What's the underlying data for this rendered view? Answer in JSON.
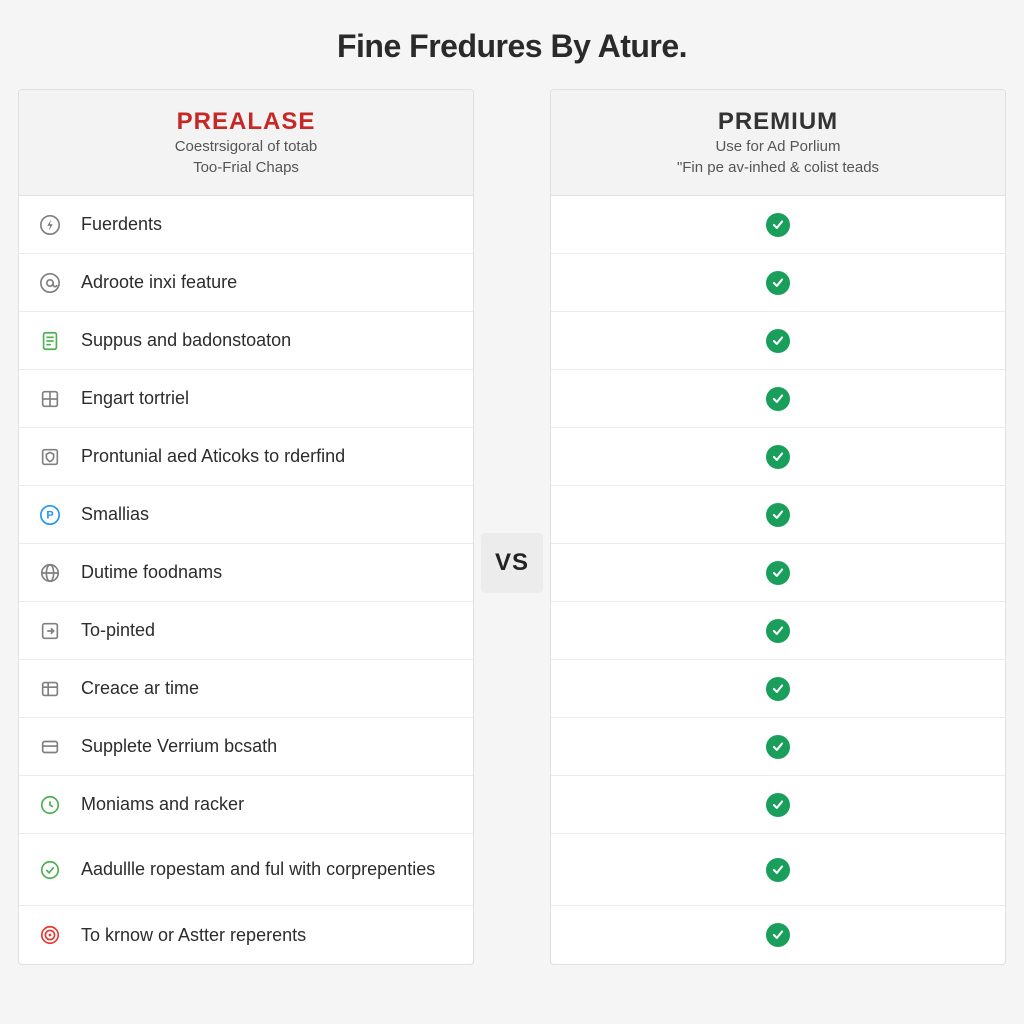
{
  "title": "Fine Fredures By Ature.",
  "vs_label": "VS",
  "plans": {
    "left": {
      "name": "PREALASE",
      "sub1": "Coestrsigoral of totab",
      "sub2": "Too-Frial Chaps"
    },
    "right": {
      "name": "PREMIUM",
      "sub1": "Use for Ad Porlium",
      "sub2": "\"Fin pe av-inhed & colist teads"
    }
  },
  "features": [
    {
      "icon": "bolt-icon",
      "label": "Fuerdents"
    },
    {
      "icon": "at-icon",
      "label": "Adroote inxi feature"
    },
    {
      "icon": "doc-icon",
      "label": "Suppus and badonstoaton"
    },
    {
      "icon": "grid-icon",
      "label": "Engart tortriel"
    },
    {
      "icon": "shield-icon",
      "label": "Prontunial aed Aticoks to rderfind"
    },
    {
      "icon": "p-circle-icon",
      "label": "Smallias"
    },
    {
      "icon": "globe-icon",
      "label": "Dutime foodnams"
    },
    {
      "icon": "arrow-icon",
      "label": "To-pinted"
    },
    {
      "icon": "table-icon",
      "label": "Creace ar time"
    },
    {
      "icon": "card-icon",
      "label": "Supplete Verrium bcsath"
    },
    {
      "icon": "clock-icon",
      "label": "Moniams and racker"
    },
    {
      "icon": "check-circle-icon",
      "label": "Aadullle ropestam and ful with corprepenties"
    },
    {
      "icon": "target-icon",
      "label": "To krnow or Astter reperents"
    }
  ],
  "icon_colors": {
    "bolt-icon": "#808080",
    "at-icon": "#808080",
    "doc-icon": "#4caf50",
    "grid-icon": "#808080",
    "shield-icon": "#808080",
    "p-circle-icon": "#2196f3",
    "globe-icon": "#808080",
    "arrow-icon": "#808080",
    "table-icon": "#808080",
    "card-icon": "#808080",
    "clock-icon": "#4caf50",
    "check-circle-icon": "#4caf50",
    "target-icon": "#e53935"
  }
}
